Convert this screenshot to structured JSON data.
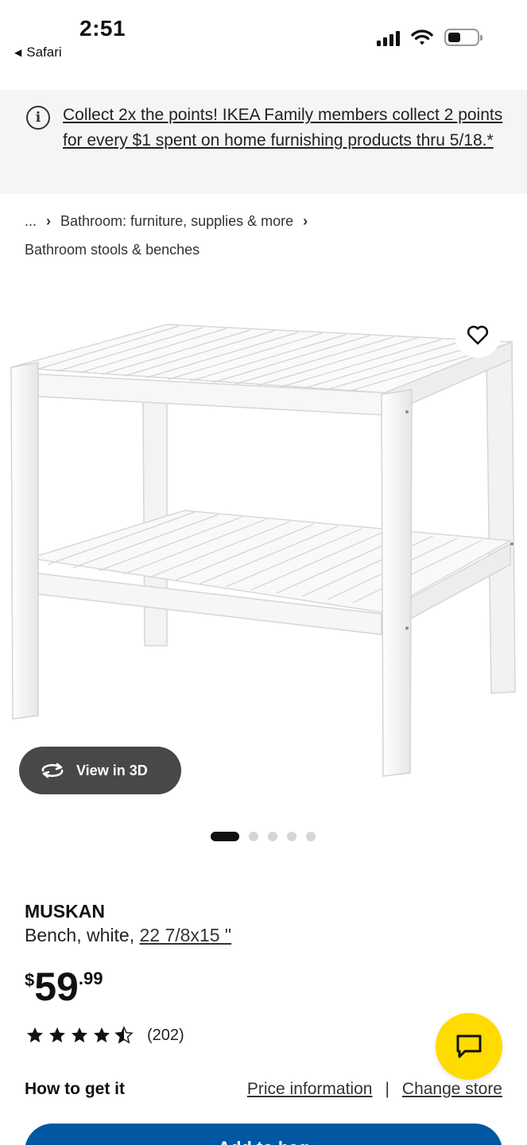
{
  "status_bar": {
    "time": "2:51",
    "back_app": "Safari"
  },
  "promo": {
    "text": "Collect 2x the points! IKEA Family members collect 2 points for every $1 spent on home furnishing products thru 5/18.*"
  },
  "breadcrumb": {
    "ellipsis": "...",
    "separator": "›",
    "items": [
      "Bathroom: furniture, supplies & more",
      "Bathroom stools & benches"
    ]
  },
  "gallery": {
    "view3d_label": "View in 3D",
    "image_count": 5,
    "active_index": 0
  },
  "product": {
    "name": "MUSKAN",
    "description": "Bench, white,",
    "dimension": "22 7/8x15 \"",
    "price": {
      "currency": "$",
      "integer": "59",
      "decimal": ".99"
    },
    "rating": {
      "value": 4.5,
      "max": 5,
      "count": "(202)"
    }
  },
  "fulfillment": {
    "heading": "How to get it",
    "price_info": "Price information",
    "divider": "|",
    "change_store": "Change store"
  },
  "cta": {
    "add_label": "Add to bag"
  },
  "colors": {
    "accent_blue": "#0058a3",
    "chat_yellow": "#ffdb00",
    "pill_dark": "#484848"
  }
}
